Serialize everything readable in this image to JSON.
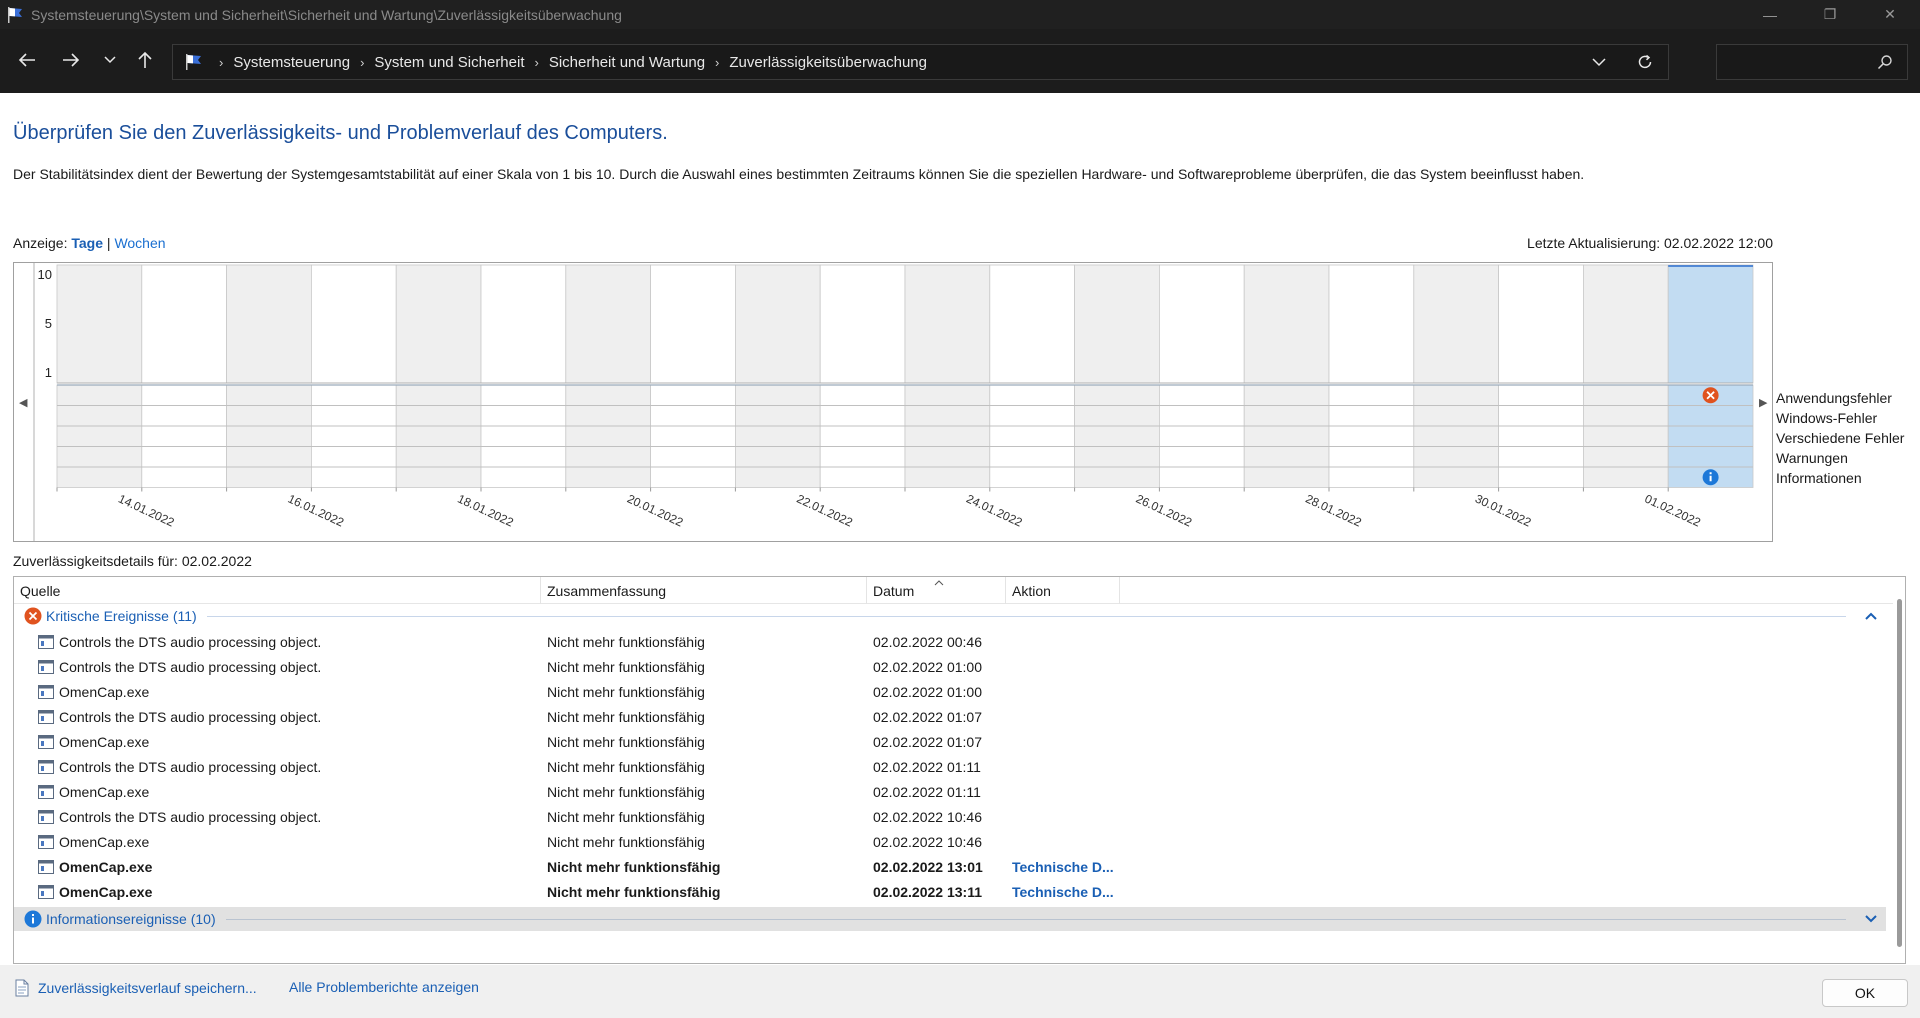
{
  "window": {
    "title": "Systemsteuerung\\System und Sicherheit\\Sicherheit und Wartung\\Zuverlässigkeitsüberwachung",
    "controls": {
      "minimize": "—",
      "maximize": "❐",
      "close": "✕"
    }
  },
  "address": {
    "crumbs": [
      "Systemsteuerung",
      "System und Sicherheit",
      "Sicherheit und Wartung",
      "Zuverlässigkeitsüberwachung"
    ],
    "search_placeholder": ""
  },
  "page": {
    "heading": "Überprüfen Sie den Zuverlässigkeits- und Problemverlauf des Computers.",
    "description": "Der Stabilitätsindex dient der Bewertung der Systemgesamtstabilität auf einer Skala von 1 bis 10. Durch die Auswahl eines bestimmten Zeitraums können Sie die speziellen Hardware- und Softwareprobleme überprüfen, die das System beeinflusst haben.",
    "view_label": "Anzeige:",
    "view_days": "Tage",
    "view_separator": "|",
    "view_weeks": "Wochen",
    "last_update": "Letzte Aktualisierung: 02.02.2022 12:00"
  },
  "chart_data": {
    "type": "table",
    "y_ticks": [
      "10",
      "5",
      "1"
    ],
    "ylim": [
      1,
      10
    ],
    "days": [
      "14.01.2022",
      "15.01.2022",
      "16.01.2022",
      "17.01.2022",
      "18.01.2022",
      "19.01.2022",
      "20.01.2022",
      "21.01.2022",
      "22.01.2022",
      "23.01.2022",
      "24.01.2022",
      "25.01.2022",
      "26.01.2022",
      "27.01.2022",
      "28.01.2022",
      "29.01.2022",
      "30.01.2022",
      "31.01.2022",
      "01.02.2022",
      "02.02.2022"
    ],
    "x_tick_labels": [
      "14.01.2022",
      "16.01.2022",
      "18.01.2022",
      "20.01.2022",
      "22.01.2022",
      "24.01.2022",
      "26.01.2022",
      "28.01.2022",
      "30.01.2022",
      "01.02.2022"
    ],
    "selected_day": "02.02.2022",
    "categories": [
      "Anwendungsfehler",
      "Windows-Fehler",
      "Verschiedene Fehler",
      "Warnungen",
      "Informationen"
    ],
    "events": [
      {
        "day": "02.02.2022",
        "category": "Anwendungsfehler",
        "icon": "error-icon"
      },
      {
        "day": "02.02.2022",
        "category": "Informationen",
        "icon": "info-icon"
      }
    ],
    "colors": {
      "shaded": "#efefef",
      "selected": "#c2dcf2",
      "error": "#e0531f",
      "info": "#1d78d8"
    }
  },
  "details": {
    "label": "Zuverlässigkeitsdetails für: 02.02.2022",
    "columns": [
      "Quelle",
      "Zusammenfassung",
      "Datum",
      "Aktion"
    ],
    "critical_group": "Kritische Ereignisse (11)",
    "info_group": "Informationsereignisse (10)",
    "rows": [
      {
        "source": "Controls the DTS audio processing object.",
        "summary": "Nicht mehr funktionsfähig",
        "date": "02.02.2022 00:46",
        "action": "",
        "bold": false
      },
      {
        "source": "Controls the DTS audio processing object.",
        "summary": "Nicht mehr funktionsfähig",
        "date": "02.02.2022 01:00",
        "action": "",
        "bold": false
      },
      {
        "source": "OmenCap.exe",
        "summary": "Nicht mehr funktionsfähig",
        "date": "02.02.2022 01:00",
        "action": "",
        "bold": false
      },
      {
        "source": "Controls the DTS audio processing object.",
        "summary": "Nicht mehr funktionsfähig",
        "date": "02.02.2022 01:07",
        "action": "",
        "bold": false
      },
      {
        "source": "OmenCap.exe",
        "summary": "Nicht mehr funktionsfähig",
        "date": "02.02.2022 01:07",
        "action": "",
        "bold": false
      },
      {
        "source": "Controls the DTS audio processing object.",
        "summary": "Nicht mehr funktionsfähig",
        "date": "02.02.2022 01:11",
        "action": "",
        "bold": false
      },
      {
        "source": "OmenCap.exe",
        "summary": "Nicht mehr funktionsfähig",
        "date": "02.02.2022 01:11",
        "action": "",
        "bold": false
      },
      {
        "source": "Controls the DTS audio processing object.",
        "summary": "Nicht mehr funktionsfähig",
        "date": "02.02.2022 10:46",
        "action": "",
        "bold": false
      },
      {
        "source": "OmenCap.exe",
        "summary": "Nicht mehr funktionsfähig",
        "date": "02.02.2022 10:46",
        "action": "",
        "bold": false
      },
      {
        "source": "OmenCap.exe",
        "summary": "Nicht mehr funktionsfähig",
        "date": "02.02.2022 13:01",
        "action": "Technische D...",
        "bold": true
      },
      {
        "source": "OmenCap.exe",
        "summary": "Nicht mehr funktionsfähig",
        "date": "02.02.2022 13:11",
        "action": "Technische D...",
        "bold": true
      }
    ]
  },
  "footer": {
    "save_link": "Zuverlässigkeitsverlauf speichern...",
    "reports_link": "Alle Problemberichte anzeigen",
    "ok": "OK"
  }
}
